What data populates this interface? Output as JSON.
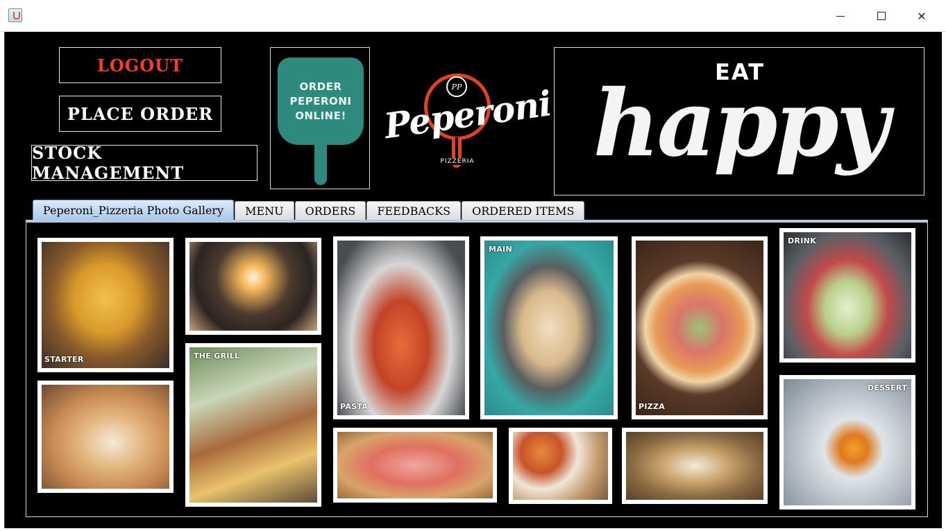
{
  "window": {
    "icon": "java-cup-icon",
    "controls": {
      "minimize": "minimize-icon",
      "maximize": "maximize-icon",
      "close": "✕"
    }
  },
  "actions": {
    "logout": "LOGOUT",
    "place_order": "PLACE ORDER",
    "stock_management": "STOCK MANAGEMENT"
  },
  "banner": {
    "order_online": "ORDER PEPERONI ONLINE!",
    "logo_badge": "PP",
    "logo_name": "Peperoni",
    "logo_sub": "PIZZERIA",
    "eat": "EAT",
    "happy": "happy"
  },
  "tabs": [
    {
      "label": "Peperoni_Pizzeria Photo Gallery",
      "active": true
    },
    {
      "label": "MENU",
      "active": false
    },
    {
      "label": "ORDERS",
      "active": false
    },
    {
      "label": "FEEDBACKS",
      "active": false
    },
    {
      "label": "ORDERED ITEMS",
      "active": false
    }
  ],
  "gallery": {
    "captions": {
      "starter": "STARTER",
      "grill": "THE GRILL",
      "pasta": "PASTA",
      "main": "MAIN",
      "pizza": "PIZZA",
      "drink": "DRINK",
      "dessert": "DESSERT"
    }
  },
  "colors": {
    "background": "#000000",
    "logout_text": "#ff3b24",
    "brand_orange": "#e2421f",
    "teal": "#2e8a7c",
    "active_tab": "#a9c8ea"
  }
}
